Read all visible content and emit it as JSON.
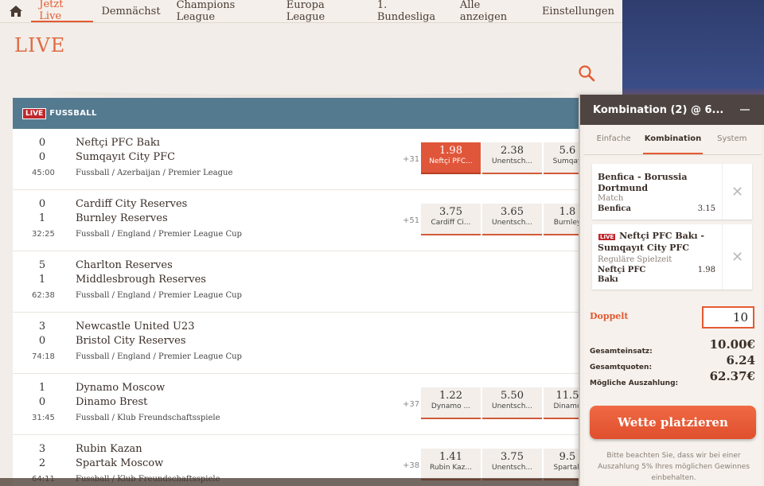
{
  "nav": {
    "items": [
      "Jetzt Live",
      "Demnächst",
      "Champions League",
      "Europa League",
      "1. Bundesliga",
      "Alle anzeigen"
    ],
    "active": "Jetzt Live",
    "settings": "Einstellungen"
  },
  "page": {
    "title": "LIVE"
  },
  "sport": {
    "badge": "LIVE",
    "title": "FUSSBALL"
  },
  "matches": [
    {
      "score1": "0",
      "score2": "0",
      "time": "45:00",
      "team1": "Neftçi PFC Bakı",
      "team2": "Sumqayıt City PFC",
      "league": "Fussball / Azerbaijan / Premier League",
      "more": "+31",
      "odds": [
        {
          "value": "1.98",
          "label": "Neftçi PFC..."
        },
        {
          "value": "2.38",
          "label": "Unentsch..."
        },
        {
          "value": "5.6",
          "label": "Sumqay"
        }
      ]
    },
    {
      "score1": "0",
      "score2": "1",
      "time": "32:25",
      "team1": "Cardiff City Reserves",
      "team2": "Burnley Reserves",
      "league": "Fussball / England / Premier League Cup",
      "more": "+51",
      "odds": [
        {
          "value": "3.75",
          "label": "Cardiff Ci..."
        },
        {
          "value": "3.65",
          "label": "Unentsch..."
        },
        {
          "value": "1.8",
          "label": "Burnley"
        }
      ]
    },
    {
      "score1": "5",
      "score2": "1",
      "time": "62:38",
      "team1": "Charlton Reserves",
      "team2": "Middlesbrough Reserves",
      "league": "Fussball / England / Premier League Cup",
      "more": "",
      "odds": []
    },
    {
      "score1": "3",
      "score2": "0",
      "time": "74:18",
      "team1": "Newcastle United U23",
      "team2": "Bristol City Reserves",
      "league": "Fussball / England / Premier League Cup",
      "more": "",
      "odds": []
    },
    {
      "score1": "1",
      "score2": "0",
      "time": "31:45",
      "team1": "Dynamo Moscow",
      "team2": "Dinamo Brest",
      "league": "Fussball / Klub Freundschaftsspiele",
      "more": "+37",
      "odds": [
        {
          "value": "1.22",
          "label": "Dynamo ..."
        },
        {
          "value": "5.50",
          "label": "Unentsch..."
        },
        {
          "value": "11.5",
          "label": "Dinamo"
        }
      ]
    },
    {
      "score1": "3",
      "score2": "2",
      "time": "64:11",
      "team1": "Rubin Kazan",
      "team2": "Spartak Moscow",
      "league": "Fussball / Klub Freundschaftsspiele",
      "more": "+38",
      "odds": [
        {
          "value": "1.41",
          "label": "Rubin Kaz..."
        },
        {
          "value": "3.75",
          "label": "Unentsch..."
        },
        {
          "value": "9.5",
          "label": "Spartak"
        }
      ]
    }
  ],
  "slip": {
    "title": "Kombination (2) @ 6...",
    "tabs": [
      "Einfache",
      "Kombination",
      "System"
    ],
    "active_tab": "Kombination",
    "selections": [
      {
        "live": "",
        "event": "Benfica - Borussia Dortmund",
        "market": "Match",
        "pick": "Benfica",
        "pick2": "",
        "odds": "3.15"
      },
      {
        "live": "LIVE",
        "event": "Neftçi PFC Bakı - Sumqayıt City PFC",
        "market": "Reguläre Spielzeit",
        "pick": "Neftçi PFC",
        "pick2": "Bakı",
        "odds": "1.98"
      }
    ],
    "stake_label": "Doppelt",
    "stake_value": "10",
    "total_stake_label": "Gesamteinsatz:",
    "total_stake": "10.00€",
    "total_odds_label": "Gesamtquoten:",
    "total_odds": "6.24",
    "payout_label": "Mögliche Auszahlung:",
    "payout": "62.37€",
    "place_button": "Wette platzieren",
    "note": "Bitte beachten Sie, dass wir bei einer Auszahlung 5% Ihres möglichen Gewinnes einbehalten."
  }
}
